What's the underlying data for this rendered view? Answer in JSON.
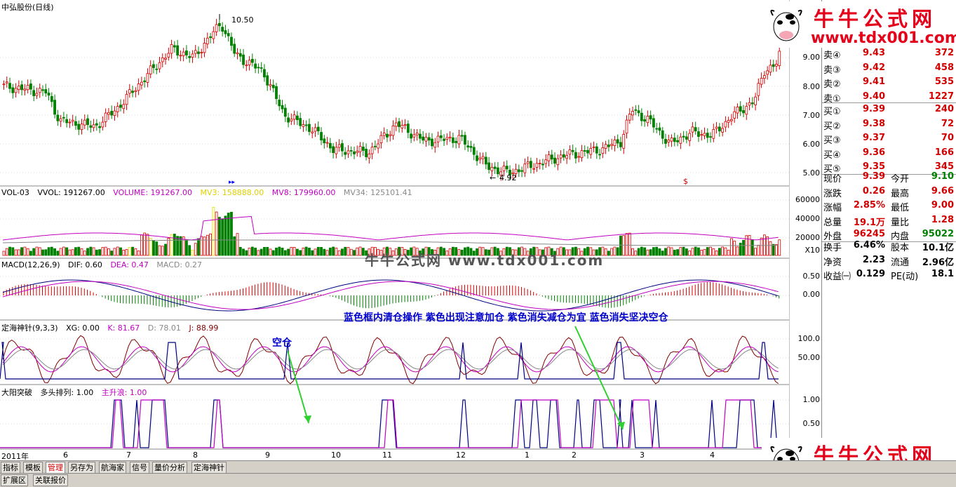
{
  "stock_title": "中弘股份(日线)",
  "price_high_label": "10.50",
  "price_low_label": "4.92",
  "price_axis": [
    "9.00",
    "8.00",
    "7.00",
    "6.00",
    "5.00"
  ],
  "vol_header": {
    "name": "VOL-03",
    "vvol": "VVOL: 191267.00",
    "volume": "VOLUME: 191267.00",
    "mv3": "MV3: 158888.00",
    "mv8": "MV8: 179960.00",
    "mv34": "MV34: 125101.41"
  },
  "vol_axis": [
    "60000",
    "40000",
    "20000"
  ],
  "vol_unit": "X10",
  "macd_header": {
    "name": "MACD(12,26,9)",
    "dif": "DIF: 0.60",
    "dea": "DEA: 0.47",
    "macd": "MACD: 0.27"
  },
  "macd_axis": [
    "0.50",
    "0.00"
  ],
  "dhzz_header": {
    "name": "定海神针(9,3,3)",
    "xg": "XG: 0.00",
    "k": "K: 81.67",
    "d": "D: 78.01",
    "j": "J: 88.99"
  },
  "dhzz_axis": [
    "100.0",
    "50.00"
  ],
  "dytp_header": {
    "name": "大阳突破",
    "dtpl": "多头排列: 1.00",
    "zsl": "主升浪: 1.00"
  },
  "dytp_axis": [
    "1.00",
    "0.50"
  ],
  "annotation_main": "蓝色框内清仓操作  紫色出现注意加仓  紫色消失减仓为宜  蓝色消失坚决空仓",
  "annotation_empty": "空仓",
  "center_watermark": "牛牛公式网  www.tdx001.com",
  "month_labels": [
    "2011年",
    "6",
    "7",
    "8",
    "9",
    "10",
    "11",
    "12",
    "1",
    "2",
    "3",
    "4"
  ],
  "watermark": {
    "title": "牛牛公式网",
    "url": "www.tdx001.com"
  },
  "quote": {
    "asks": [
      {
        "label": "卖④",
        "price": "9.43",
        "vol": "372"
      },
      {
        "label": "卖③",
        "price": "9.42",
        "vol": "458"
      },
      {
        "label": "卖②",
        "price": "9.41",
        "vol": "535"
      },
      {
        "label": "卖①",
        "price": "9.40",
        "vol": "1227"
      }
    ],
    "bids": [
      {
        "label": "买①",
        "price": "9.39",
        "vol": "240"
      },
      {
        "label": "买②",
        "price": "9.38",
        "vol": "72"
      },
      {
        "label": "买③",
        "price": "9.37",
        "vol": "70"
      },
      {
        "label": "买④",
        "price": "9.36",
        "vol": "166"
      },
      {
        "label": "买⑤",
        "price": "9.35",
        "vol": "345"
      }
    ],
    "stats": [
      {
        "l1": "现价",
        "v1": "9.39",
        "l2": "今开",
        "v2": "9.10"
      },
      {
        "l1": "涨跌",
        "v1": "0.26",
        "l2": "最高",
        "v2": "9.66"
      },
      {
        "l1": "涨幅",
        "v1": "2.85%",
        "l2": "最低",
        "v2": "9.00"
      },
      {
        "l1": "总量",
        "v1": "19.1万",
        "l2": "量比",
        "v2": "1.28"
      },
      {
        "l1": "外盘",
        "v1": "96245",
        "l2": "内盘",
        "v2": "95022"
      }
    ],
    "stats2": [
      {
        "l1": "换手",
        "v1": "6.46%",
        "l2": "股本",
        "v2": "10.1亿"
      },
      {
        "l1": "净资",
        "v1": "2.23",
        "l2": "流通",
        "v2": "2.96亿"
      },
      {
        "l1": "收益㈠",
        "v1": "0.129",
        "l2": "PE(动)",
        "v2": "18.1"
      }
    ]
  },
  "tabs": [
    "指标",
    "模板",
    "管理",
    "另存为",
    "航海家",
    "信号",
    "量价分析",
    "定海神针"
  ],
  "tabs2": [
    "扩展区",
    "关联报价"
  ]
}
